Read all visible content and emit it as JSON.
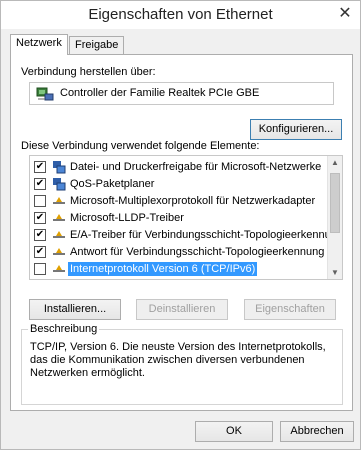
{
  "window": {
    "title": "Eigenschaften von Ethernet"
  },
  "tabs": [
    {
      "label": "Netzwerk",
      "active": true
    },
    {
      "label": "Freigabe",
      "active": false
    }
  ],
  "connect_using": {
    "label": "Verbindung herstellen über:",
    "adapter": "Controller der Familie Realtek PCIe GBE",
    "configure_button": "Konfigurieren..."
  },
  "items": {
    "label": "Diese Verbindung verwendet folgende Elemente:",
    "rows": [
      {
        "text": "Datei- und Druckerfreigabe für Microsoft-Netzwerke",
        "checked": true,
        "icon": "network-service-icon"
      },
      {
        "text": "QoS-Paketplaner",
        "checked": true,
        "icon": "network-service-icon"
      },
      {
        "text": "Microsoft-Multiplexorprotokoll für Netzwerkadapter",
        "checked": false,
        "icon": "protocol-icon"
      },
      {
        "text": "Microsoft-LLDP-Treiber",
        "checked": true,
        "icon": "protocol-icon"
      },
      {
        "text": "E/A-Treiber für Verbindungsschicht-Topologieerkennur",
        "checked": true,
        "icon": "protocol-icon"
      },
      {
        "text": "Antwort für Verbindungsschicht-Topologieerkennung",
        "checked": true,
        "icon": "protocol-icon"
      },
      {
        "text": "Internetprotokoll Version 6 (TCP/IPv6)",
        "checked": false,
        "icon": "protocol-icon",
        "selected": true
      }
    ]
  },
  "actions": {
    "install": "Installieren...",
    "uninstall": "Deinstallieren",
    "properties": "Eigenschaften"
  },
  "description": {
    "legend": "Beschreibung",
    "text": "TCP/IP, Version 6. Die neuste Version des Internetprotokolls, das die Kommunikation zwischen diversen verbundenen Netzwerken ermöglicht."
  },
  "footer": {
    "ok": "OK",
    "cancel": "Abbrechen"
  },
  "colors": {
    "selection": "#3399ff",
    "window_bg": "#f0f0f0",
    "panel_bg": "#ffffff"
  }
}
